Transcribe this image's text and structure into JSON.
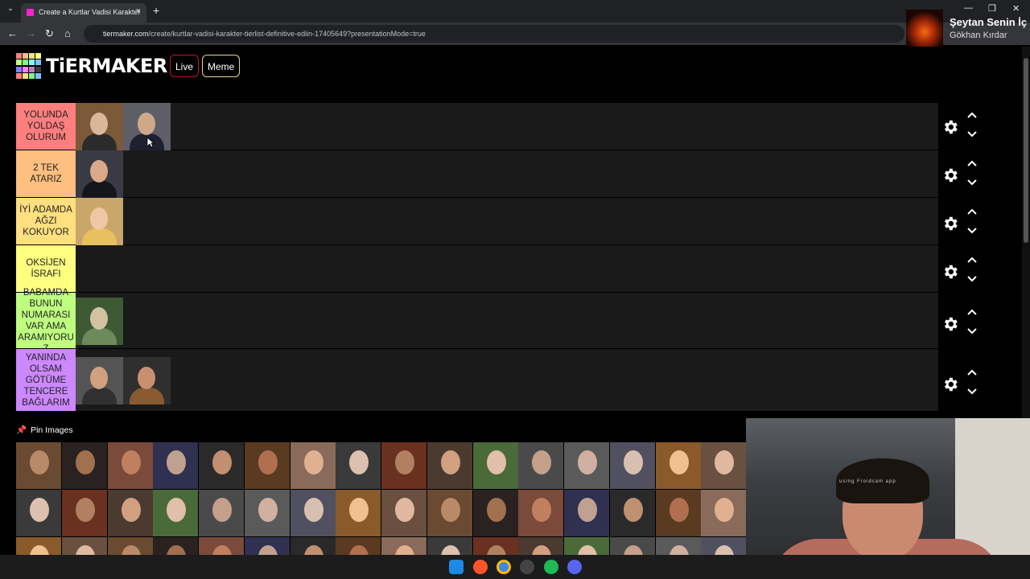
{
  "browser": {
    "tab_title": "Create a Kurtlar Vadisi Karakter",
    "tab_close": "×",
    "new_tab": "+",
    "url_host": "tiermaker.com",
    "url_path": "/create/kurtlar-vadisi-karakter-tierlist-definitive-ediin-17405649?presentationMode=true",
    "back": "←",
    "forward": "→",
    "reload": "↻",
    "home": "⌂",
    "tab_menu": "⌄",
    "minimize": "—",
    "maximize": "❐",
    "close": "✕"
  },
  "site": {
    "logo_text": "TiERMAKER",
    "logo_colors": [
      "#ff7f7f",
      "#ffbf7f",
      "#ffdf7f",
      "#ffff7f",
      "#bfff7f",
      "#7fff7f",
      "#7fffff",
      "#7fbfff",
      "#7f7fff",
      "#ff7fff",
      "#bf7fbf",
      "#3b3b3b",
      "#ff7f7f",
      "#ffdf7f",
      "#7fff7f",
      "#7fbfff"
    ],
    "live_label": "Live",
    "meme_label": "Meme",
    "pin_icon": "📌",
    "pin_label": "Pin Images"
  },
  "tiers": [
    {
      "label": "YOLUNDA YOLDAŞ OLURUM",
      "color": "#ff7f7f",
      "items": 2
    },
    {
      "label": "2 TEK ATARIZ",
      "color": "#ffbf7f",
      "items": 1
    },
    {
      "label": "İYİ ADAMDA AĞZI KOKUYOR",
      "color": "#ffdf7f",
      "items": 1
    },
    {
      "label": "OKSİJEN İSRAFI",
      "color": "#ffff7f",
      "items": 0
    },
    {
      "label": "BABAMDA BUNUN NUMARASI VAR AMA ARAMIYORUZ",
      "color": "#bfff7f",
      "items": 1
    },
    {
      "label": "YANINDA OLSAM GÖTÜME TENCERE BAĞLARIM",
      "color": "#cc88ff",
      "items": 2
    }
  ],
  "tier_controls": {
    "settings_icon": "gear-icon",
    "up": "⌃",
    "down": "⌄"
  },
  "now_playing": {
    "title": "Şeytan Senin İç",
    "artist": "Gökhan Kırdar"
  },
  "webcam": {
    "watermark": "using Froidcam app"
  }
}
